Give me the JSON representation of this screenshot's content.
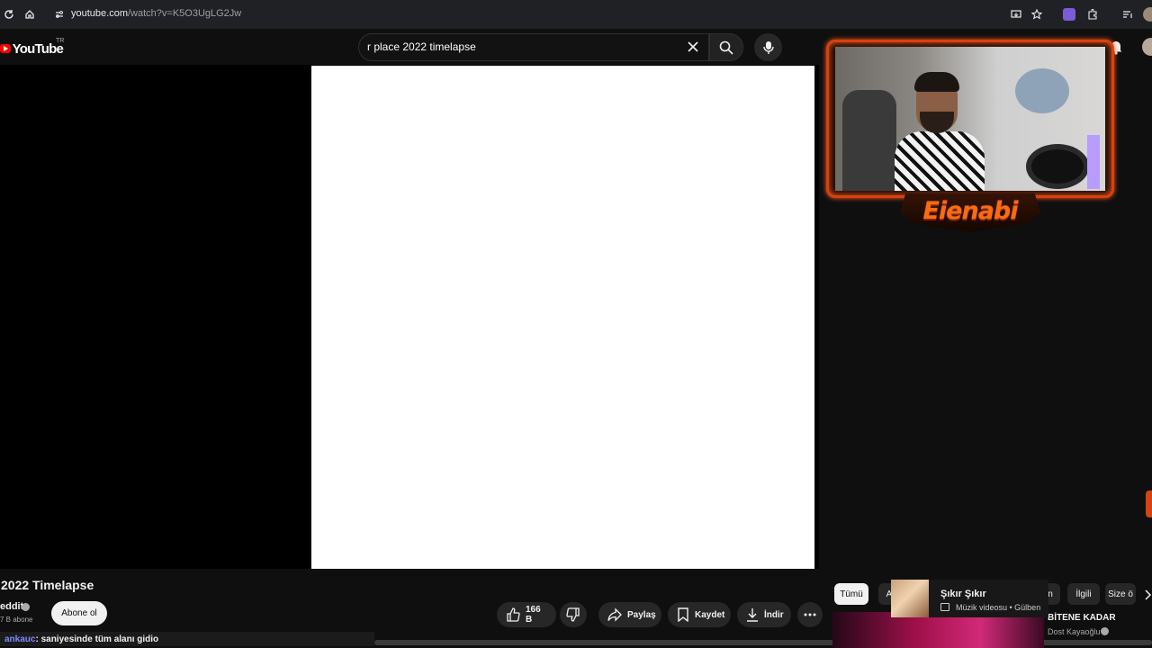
{
  "browser": {
    "url_host": "youtube.com",
    "url_path": "/watch?v=K5O3UgLG2Jw"
  },
  "header": {
    "logo_text": "YouTube",
    "region_code": "TR",
    "search_query": "r place 2022 timelapse"
  },
  "webcam": {
    "streamer_name": "Eienabi"
  },
  "video": {
    "title": "2022 Timelapse",
    "channel_name": "eddit",
    "subscriber_count": "7 B abone",
    "subscribe_label": "Abone ol"
  },
  "actions": {
    "like_count": "166 B",
    "share_label": "Paylaş",
    "save_label": "Kaydet",
    "download_label": "İndir"
  },
  "chat": {
    "user": "ankauc",
    "message": ": saniyesinde tüm alanı gidio"
  },
  "chips": {
    "all": "Tümü",
    "a": "A",
    "n": "n",
    "related": "İlgili",
    "for_you": "Size ö"
  },
  "now_playing": {
    "title": "Şıkır Şıkır",
    "meta": "Müzik videosu • Gülben"
  },
  "recommended": {
    "title": "BİTENE KADAR",
    "channel": "Dost Kayaoğlu"
  },
  "colors": {
    "youtube_red": "#ff0000",
    "overlay_accent": "#d9410f",
    "background": "#0f0f0f"
  }
}
